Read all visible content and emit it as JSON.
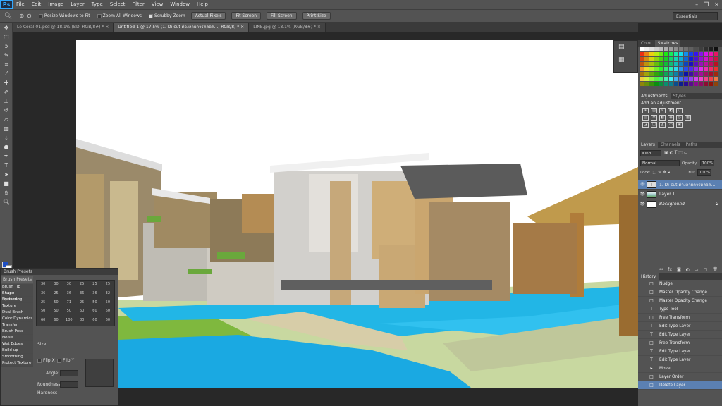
{
  "app": {
    "logo": "Ps"
  },
  "menu": [
    "File",
    "Edit",
    "Image",
    "Layer",
    "Type",
    "Select",
    "Filter",
    "View",
    "Window",
    "Help"
  ],
  "window_controls": [
    "–",
    "❐",
    "✕"
  ],
  "options": {
    "resize_windows": "Resize Windows to Fit",
    "zoom_all": "Zoom All Windows",
    "scrubby_zoom": "Scrubby Zoom",
    "actual_pixels": "Actual Pixels",
    "fit_screen": "Fit Screen",
    "fill_screen": "Fill Screen",
    "print_size": "Print Size",
    "workspace": "Essentials"
  },
  "tabs": [
    "Le Coral 01.psd @ 18.1% (BD, RGB/8#) * ×",
    "Untitled-1 @ 17.5% (1. Di-cut ดีวงลายการตลอด..., RGB/8) * ×",
    "LINE.jpg @ 18.1% (RGB/8#) * ×"
  ],
  "brush_panel": {
    "header": "Brush Presets",
    "button": "Brush Presets",
    "options": [
      "Brush Tip Shape",
      "Shape Dynamics",
      "Scattering",
      "Texture",
      "Dual Brush",
      "Color Dynamics",
      "Transfer",
      "Brush Pose",
      "Noise",
      "Wet Edges",
      "Build-up",
      "Smoothing",
      "Protect Texture"
    ],
    "numbers": [
      "30",
      "30",
      "30",
      "25",
      "25",
      "25",
      "36",
      "25",
      "36",
      "36",
      "36",
      "32",
      "25",
      "50",
      "71",
      "25",
      "50",
      "50",
      "50",
      "50",
      "50",
      "60",
      "60",
      "60",
      "60",
      "60",
      "100",
      "80",
      "60",
      "60"
    ],
    "size_label": "Size",
    "flip_x": "Flip X",
    "flip_y": "Flip Y",
    "angle": "Angle:",
    "roundness": "Roundness:",
    "hardness": "Hardness"
  },
  "swatches_panel": {
    "tabs": [
      "Color",
      "Swatches"
    ]
  },
  "adjustments_panel": {
    "tabs": [
      "Adjustments",
      "Styles"
    ],
    "title": "Add an adjustment"
  },
  "layers_panel": {
    "tabs": [
      "Layers",
      "Channels",
      "Paths"
    ],
    "kind": "Kind",
    "blend": "Normal",
    "opacity_label": "Opacity:",
    "opacity": "100%",
    "lock_label": "Lock:",
    "fill_label": "Fill:",
    "fill": "100%",
    "layers": [
      {
        "name": "1. Di-cut ดีวงลายการตลอด...",
        "type": "T",
        "selected": true
      },
      {
        "name": "Layer 1",
        "type": "img",
        "selected": false
      },
      {
        "name": "Background",
        "type": "bg",
        "selected": false
      }
    ]
  },
  "history_panel": {
    "title": "History",
    "items": [
      {
        "label": "Nudge",
        "icon": "□"
      },
      {
        "label": "Master Opacity Change",
        "icon": "□"
      },
      {
        "label": "Master Opacity Change",
        "icon": "□"
      },
      {
        "label": "Type Tool",
        "icon": "T"
      },
      {
        "label": "Free Transform",
        "icon": "□"
      },
      {
        "label": "Edit Type Layer",
        "icon": "T"
      },
      {
        "label": "Edit Type Layer",
        "icon": "T"
      },
      {
        "label": "Free Transform",
        "icon": "□"
      },
      {
        "label": "Edit Type Layer",
        "icon": "T"
      },
      {
        "label": "Edit Type Layer",
        "icon": "T"
      },
      {
        "label": "Move",
        "icon": "▸"
      },
      {
        "label": "Layer Order",
        "icon": "□"
      },
      {
        "label": "Delete Layer",
        "icon": "□"
      }
    ]
  },
  "colors": {
    "foreground": "#1f4fc4",
    "background": "#ffffff",
    "selection": "#5b80b2"
  }
}
